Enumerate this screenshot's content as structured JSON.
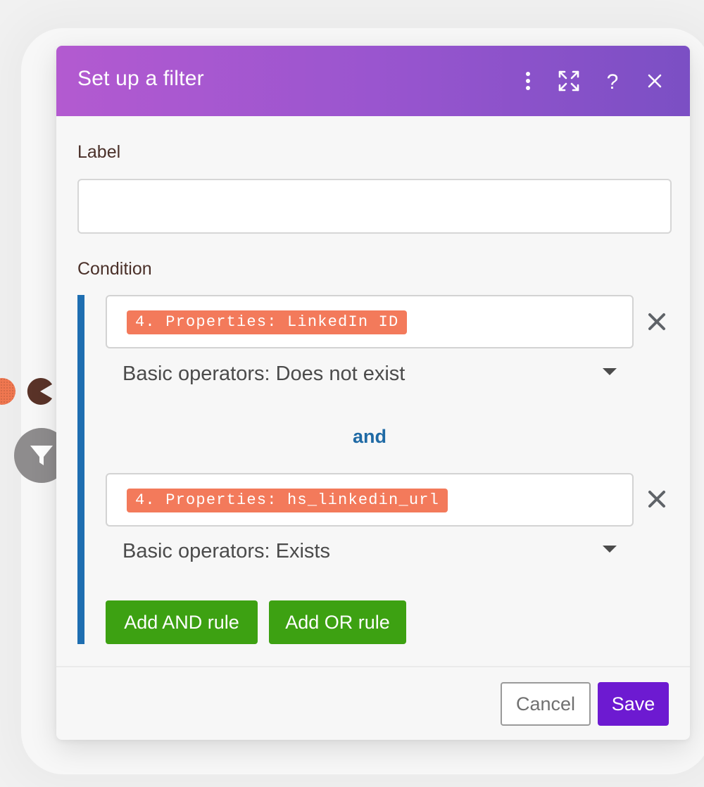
{
  "dialog": {
    "title": "Set up a filter",
    "header_icons": [
      "more-vertical-icon",
      "expand-icon",
      "help-icon",
      "close-icon"
    ]
  },
  "label_field": {
    "label": "Label",
    "value": "",
    "placeholder": ""
  },
  "condition": {
    "label": "Condition",
    "rules": [
      {
        "field": "4. Properties: LinkedIn ID",
        "operator": "Basic operators: Does not exist"
      },
      {
        "field": "4. Properties: hs_linkedin_url",
        "operator": "Basic operators: Exists"
      }
    ],
    "joiner": "and",
    "add_and_label": "Add AND rule",
    "add_or_label": "Add OR rule"
  },
  "footer": {
    "cancel_label": "Cancel",
    "save_label": "Save"
  },
  "colors": {
    "header_gradient_start": "#b35ad0",
    "header_gradient_end": "#7b4fc4",
    "pill": "#f37a5b",
    "condition_bar": "#1e6eb1",
    "green_button": "#3da112",
    "save_button": "#6d1ad1"
  }
}
